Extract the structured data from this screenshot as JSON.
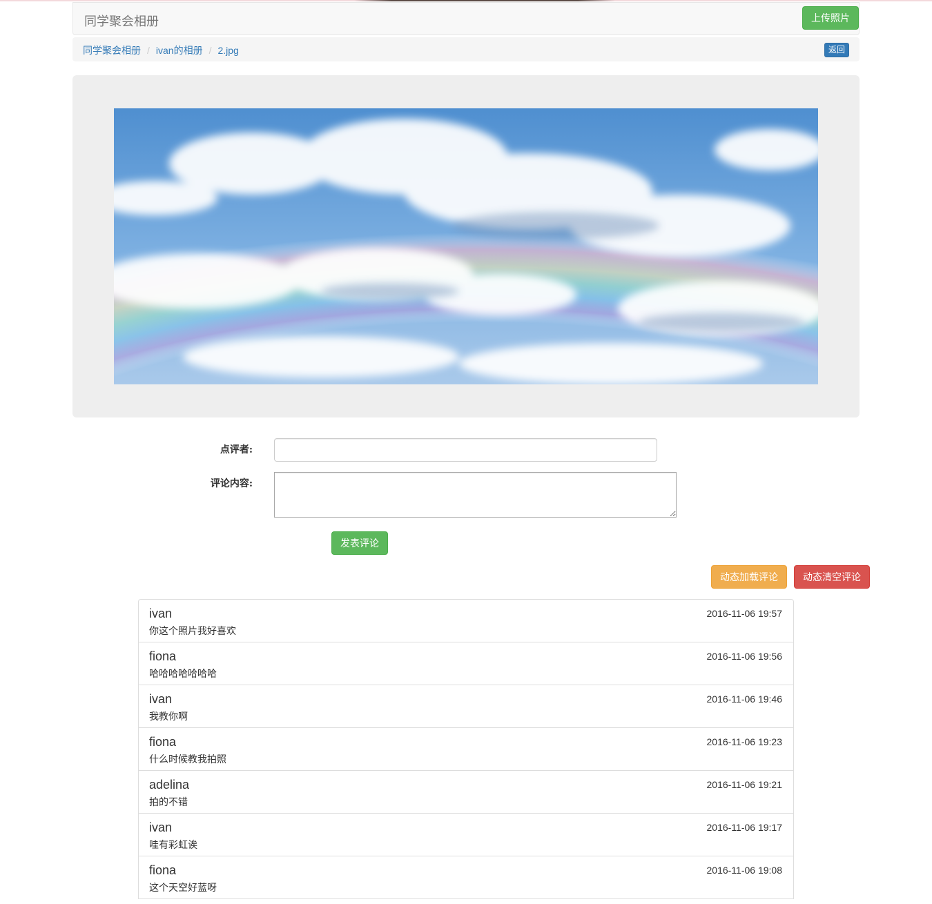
{
  "navbar": {
    "brand": "同学聚会相册",
    "upload_label": "上传照片"
  },
  "breadcrumb": {
    "items": [
      "同学聚会相册",
      "ivan的相册",
      "2.jpg"
    ],
    "separator": "/",
    "back_label": "返回"
  },
  "photo": {
    "description_icon": "photo-image",
    "colors": {
      "sky": "#5d9bd6",
      "cloud": "#ffffff"
    }
  },
  "form": {
    "reviewer_label": "点评者:",
    "reviewer_value": "",
    "content_label": "评论内容:",
    "content_value": "",
    "submit_label": "发表评论"
  },
  "actions": {
    "load_label": "动态加载评论",
    "clear_label": "动态清空评论"
  },
  "comments": [
    {
      "user": "ivan",
      "time": "2016-11-06 19:57",
      "text": "你这个照片我好喜欢"
    },
    {
      "user": "fiona",
      "time": "2016-11-06 19:56",
      "text": "哈哈哈哈哈哈哈"
    },
    {
      "user": "ivan",
      "time": "2016-11-06 19:46",
      "text": "我教你啊"
    },
    {
      "user": "fiona",
      "time": "2016-11-06 19:23",
      "text": "什么时候教我拍照"
    },
    {
      "user": "adelina",
      "time": "2016-11-06 19:21",
      "text": "拍的不错"
    },
    {
      "user": "ivan",
      "time": "2016-11-06 19:17",
      "text": "哇有彩虹诶"
    },
    {
      "user": "fiona",
      "time": "2016-11-06 19:08",
      "text": "这个天空好蓝呀"
    }
  ],
  "theme": {
    "success": "#5cb85c",
    "warning": "#f0ad4e",
    "danger": "#d9534f",
    "primary": "#337ab7",
    "link": "#337ab7"
  }
}
